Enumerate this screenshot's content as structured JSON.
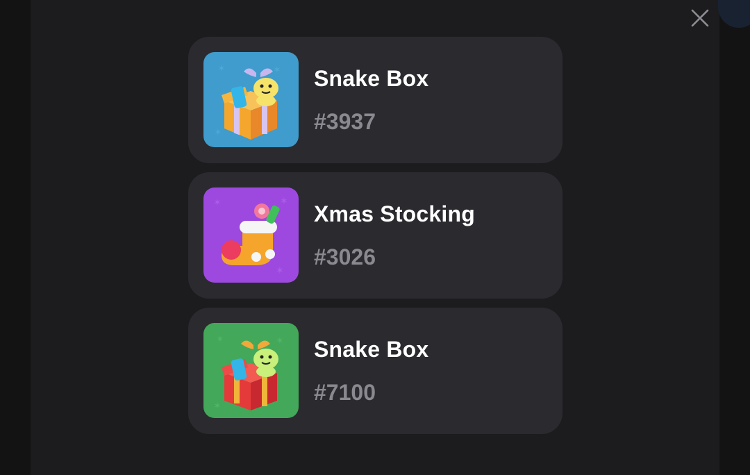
{
  "modal": {
    "close_icon": "close-icon",
    "gifts": [
      {
        "name": "Snake Box",
        "number": "#3937",
        "background": "#3f9ccc",
        "icon": "snake-box-gift-icon"
      },
      {
        "name": "Xmas Stocking",
        "number": "#3026",
        "background": "#9d49e0",
        "icon": "xmas-stocking-icon"
      },
      {
        "name": "Snake Box",
        "number": "#7100",
        "background": "#43a85a",
        "icon": "snake-box-gift-icon"
      }
    ]
  },
  "colors": {
    "page_bg": "#121213",
    "modal_bg": "#1c1c1e",
    "card_bg": "#2b2a2f",
    "title_text": "#ffffff",
    "number_text": "#8a8990"
  }
}
